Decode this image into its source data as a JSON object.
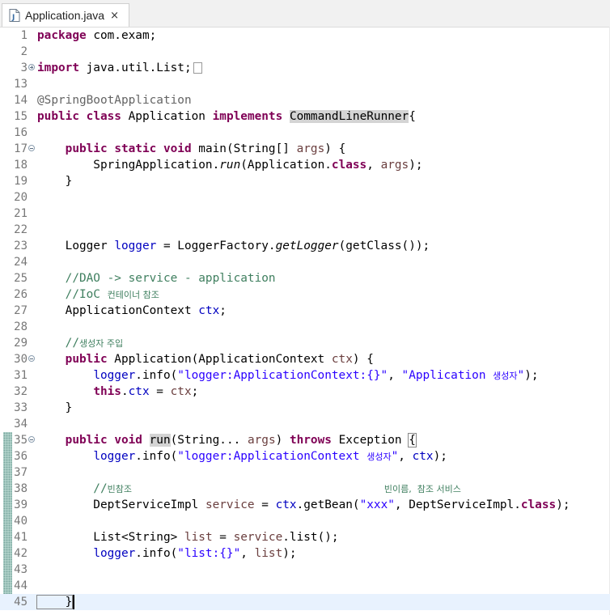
{
  "tab": {
    "title": "Application.java",
    "close_glyph": "×",
    "icon": "java-file-icon"
  },
  "lines": [
    {
      "n": "1"
    },
    {
      "n": "2"
    },
    {
      "n": "3"
    },
    {
      "n": "13"
    },
    {
      "n": "14"
    },
    {
      "n": "15"
    },
    {
      "n": "16"
    },
    {
      "n": "17"
    },
    {
      "n": "18"
    },
    {
      "n": "19"
    },
    {
      "n": "20"
    },
    {
      "n": "21"
    },
    {
      "n": "22"
    },
    {
      "n": "23"
    },
    {
      "n": "24"
    },
    {
      "n": "25"
    },
    {
      "n": "26"
    },
    {
      "n": "27"
    },
    {
      "n": "28"
    },
    {
      "n": "29"
    },
    {
      "n": "30"
    },
    {
      "n": "31"
    },
    {
      "n": "32"
    },
    {
      "n": "33"
    },
    {
      "n": "34"
    },
    {
      "n": "35"
    },
    {
      "n": "36"
    },
    {
      "n": "37"
    },
    {
      "n": "38"
    },
    {
      "n": "39"
    },
    {
      "n": "40"
    },
    {
      "n": "41"
    },
    {
      "n": "42"
    },
    {
      "n": "43"
    },
    {
      "n": "44"
    },
    {
      "n": "45"
    }
  ],
  "t": {
    "l1a": "package",
    "l1b": " com.exam;",
    "l3a": "import",
    "l3b": " java.util.List;",
    "l14": "@SpringBootApplication",
    "l15a": "public",
    "l15b": " ",
    "l15c": "class",
    "l15d": " Application ",
    "l15e": "implements",
    "l15f": " ",
    "l15g": "CommandLineRunner",
    "l15h": "{",
    "l17a": "    ",
    "l17b": "public",
    "l17c": " ",
    "l17d": "static",
    "l17e": " ",
    "l17f": "void",
    "l17g": " main(String[] ",
    "l17h": "args",
    "l17i": ") {",
    "l18a": "        SpringApplication.",
    "l18b": "run",
    "l18c": "(Application.",
    "l18d": "class",
    "l18e": ", ",
    "l18f": "args",
    "l18g": ");",
    "l19": "    }",
    "l23a": "    Logger ",
    "l23b": "logger",
    "l23c": " = LoggerFactory.",
    "l23d": "getLogger",
    "l23e": "(getClass());",
    "l25": "    //DAO -> service - application",
    "l26a": "    //IoC ",
    "l26b": "컨테이너 참조",
    "l27a": "    ApplicationContext ",
    "l27b": "ctx",
    "l27c": ";",
    "l29a": "    //",
    "l29b": "생성자 주입",
    "l30a": "    ",
    "l30b": "public",
    "l30c": " Application(ApplicationContext ",
    "l30d": "ctx",
    "l30e": ") {",
    "l31a": "        ",
    "l31b": "logger",
    "l31c": ".info(",
    "l31d": "\"logger:ApplicationContext:{}\"",
    "l31e": ", ",
    "l31f": "\"Application ",
    "l31g": "생성자",
    "l31h": "\"",
    "l31i": ");",
    "l32a": "        ",
    "l32b": "this",
    "l32c": ".",
    "l32d": "ctx",
    "l32e": " = ",
    "l32f": "ctx",
    "l32g": ";",
    "l33": "    }",
    "l35a": "    ",
    "l35b": "public",
    "l35c": " ",
    "l35d": "void",
    "l35e": " ",
    "l35f": "run",
    "l35g": "(String... ",
    "l35h": "args",
    "l35i": ") ",
    "l35j": "throws",
    "l35k": " Exception ",
    "l35l": "{",
    "l36a": "        ",
    "l36b": "logger",
    "l36c": ".info(",
    "l36d": "\"logger:ApplicationContext ",
    "l36e": "생성자",
    "l36f": "\"",
    "l36g": ", ",
    "l36h": "ctx",
    "l36i": ");",
    "l38a": "        //",
    "l38b": "빈참조",
    "l38c": "                                    ",
    "l38d": "빈이름,  참조 서비스",
    "l39a": "        DeptServiceImpl ",
    "l39b": "service",
    "l39c": " = ",
    "l39d": "ctx",
    "l39e": ".getBean(",
    "l39f": "\"xxx\"",
    "l39g": ", DeptServiceImpl.",
    "l39h": "class",
    "l39i": ");",
    "l41a": "        List<String> ",
    "l41b": "list",
    "l41c": " = ",
    "l41d": "service",
    "l41e": ".list();",
    "l42a": "        ",
    "l42b": "logger",
    "l42c": ".info(",
    "l42d": "\"list:{}\"",
    "l42e": ", ",
    "l42f": "list",
    "l42g": ");",
    "l45": "    }"
  }
}
